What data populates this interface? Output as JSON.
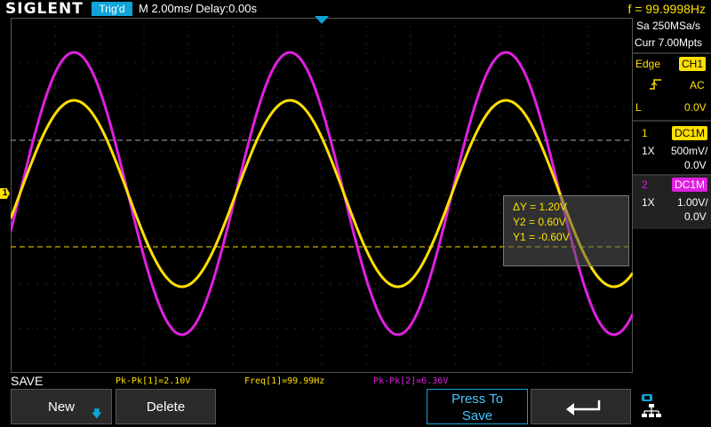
{
  "header": {
    "brand": "SIGLENT",
    "trigger_status": "Trig'd",
    "timebase": "M 2.00ms/ Delay:0.00s",
    "frequency": "f = 99.9998Hz"
  },
  "screen": {
    "ch1_marker": "1",
    "cursor": {
      "delta_y": "ΔY = 1.20V",
      "y2": "Y2 = 0.60V",
      "y1": "Y1 = -0.60V"
    }
  },
  "right_panel": {
    "sample_rate": "Sa 250MSa/s",
    "memory": "Curr 7.00Mpts",
    "trigger_type": "Edge",
    "trigger_source": "CH1",
    "slope_icon": "rising-edge-icon",
    "coupling": "AC",
    "level_label": "L",
    "level_value": "0.0V",
    "ch1": {
      "num": "1",
      "coupling": "DC1M",
      "probe": "1X",
      "scale": "500mV/",
      "offset": "0.0V"
    },
    "ch2": {
      "num": "2",
      "coupling": "DC1M",
      "probe": "1X",
      "scale": "1.00V/",
      "offset": "0.0V"
    }
  },
  "measurements": {
    "pkpk1": "Pk-Pk[1]=2.10V",
    "freq1": "Freq[1]=99.99Hz",
    "pkpk2": "Pk-Pk[2]=6.36V"
  },
  "menu": {
    "title": "SAVE",
    "new_label": "New",
    "delete_label": "Delete",
    "press_to_save_line1": "Press To",
    "press_to_save_line2": "Save",
    "back_icon": "return-arrow-icon",
    "network_icon": "network-icon"
  },
  "colors": {
    "ch1": "#ffe000",
    "ch2": "#e020e0",
    "accent": "#0fa3d8"
  },
  "waveforms": {
    "ch1": {
      "peak_to_peak_divisions": 4.2,
      "frequency_hz": 99.99,
      "phase_deg": 0
    },
    "ch2": {
      "peak_to_peak_divisions": 6.36,
      "frequency_hz": 99.99,
      "phase_deg": 0
    }
  }
}
